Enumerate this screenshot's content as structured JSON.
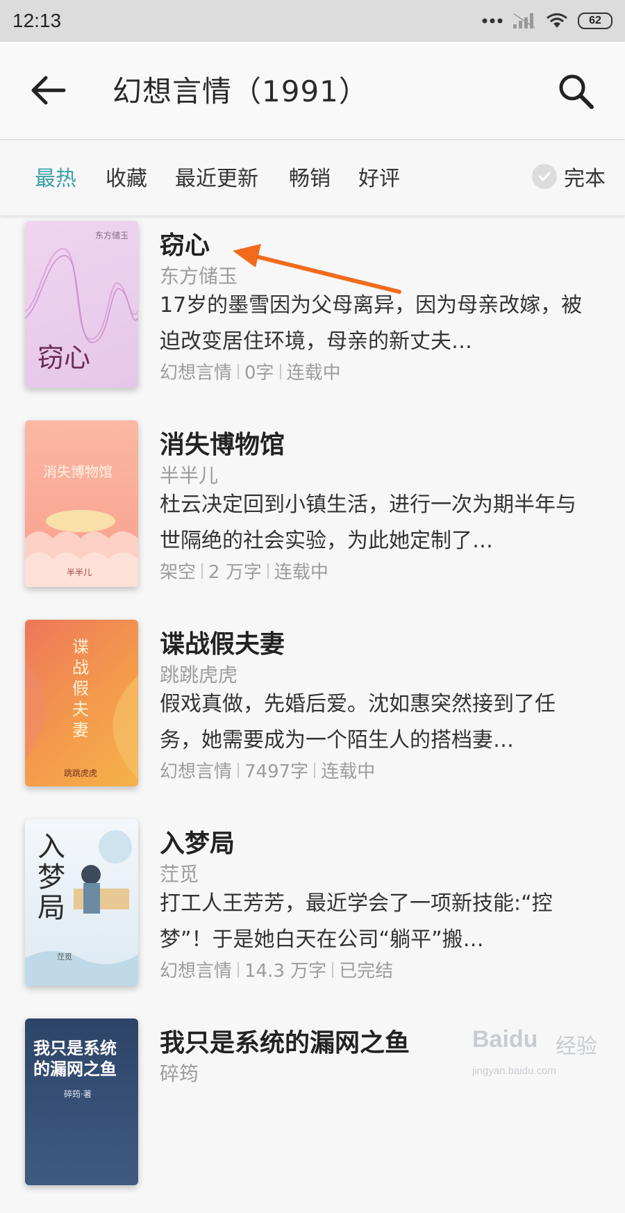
{
  "status_bar": {
    "time": "12:13",
    "battery": "62"
  },
  "header": {
    "title": "幻想言情（1991）"
  },
  "tabs": [
    "最热",
    "收藏",
    "最近更新",
    "畅销",
    "好评"
  ],
  "filter_toggle": {
    "label": "完本"
  },
  "books": [
    {
      "title": "窃心",
      "author": "东方储玉",
      "desc": "17岁的墨雪因为父母离异，因为母亲改嫁，被迫改变居住环境，母亲的新丈夫…",
      "meta": [
        "幻想言情",
        "0字",
        "连载中"
      ],
      "cover_title": "窃心",
      "cover_author": "东方储玉"
    },
    {
      "title": "消失博物馆",
      "author": "半半儿",
      "desc": "杜云决定回到小镇生活，进行一次为期半年与世隔绝的社会实验，为此她定制了…",
      "meta": [
        "架空",
        "2 万字",
        "连载中"
      ],
      "cover_title": "消失博物馆",
      "cover_author": "半半儿"
    },
    {
      "title": "谍战假夫妻",
      "author": "跳跳虎虎",
      "desc": "假戏真做，先婚后爱。沈如惠突然接到了任务，她需要成为一个陌生人的搭档妻…",
      "meta": [
        "幻想言情",
        "7497字",
        "连载中"
      ],
      "cover_title": "谍战假夫妻",
      "cover_author": "跳跳虎虎"
    },
    {
      "title": "入梦局",
      "author": "茳觅",
      "desc": "打工人王芳芳，最近学会了一项新技能:“控梦”！于是她白天在公司“躺平”搬…",
      "meta": [
        "幻想言情",
        "14.3 万字",
        "已完结"
      ],
      "cover_title": "入梦局",
      "cover_author": "茳觅"
    },
    {
      "title": "我只是系统的漏网之鱼",
      "author": "碎筠",
      "desc": "",
      "meta": [],
      "cover_title": "我只是系统的漏网之鱼",
      "cover_author": "碎筠·著"
    }
  ],
  "watermark": {
    "brand": "Baidu",
    "sub": "经验",
    "url": "jingyan.baidu.com"
  },
  "colors": {
    "accent": "#3aa0a8",
    "annotation_arrow": "#f26b1d"
  }
}
